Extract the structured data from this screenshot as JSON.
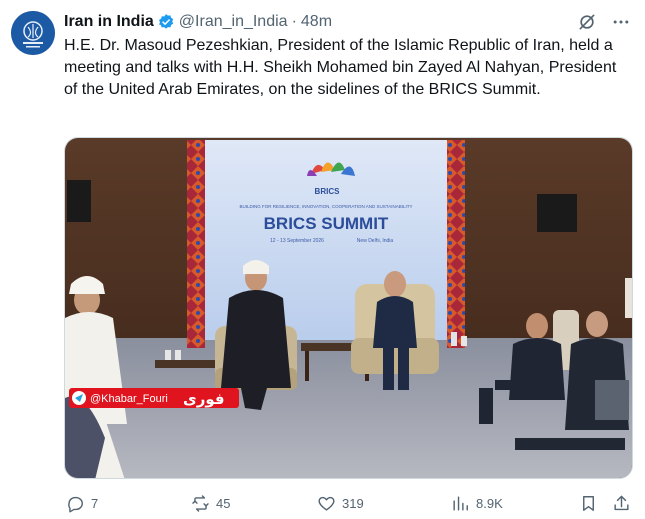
{
  "author": {
    "name": "Iran in India",
    "handle": "@Iran_in_India",
    "separator": "·",
    "time": "48m"
  },
  "tweet": {
    "text": "H.E. Dr. Masoud Pezeshkian, President of the Islamic Republic of Iran, held a meeting and talks with H.H. Sheikh Mohamed bin Zayed Al Nahyan, President of the United Arab Emirates, on the sidelines of the BRICS Summit."
  },
  "media": {
    "banner_tagline": "BUILDING FOR RESILIENCE, INNOVATION, COOPERATION AND SUSTAINABILITY",
    "banner_title": "BRICS SUMMIT",
    "banner_date": "12 - 13 September 2026",
    "banner_location": "New Delhi, India",
    "logo_text": "BRICS",
    "watermark_handle": "@Khabar_Fouri",
    "watermark_brand": "فوری"
  },
  "actions": {
    "replies": "7",
    "reposts": "45",
    "likes": "319",
    "views": "8.9K"
  },
  "colors": {
    "verified": "#1d9bf0",
    "text_secondary": "#536471",
    "watermark_red": "#e0141e"
  }
}
